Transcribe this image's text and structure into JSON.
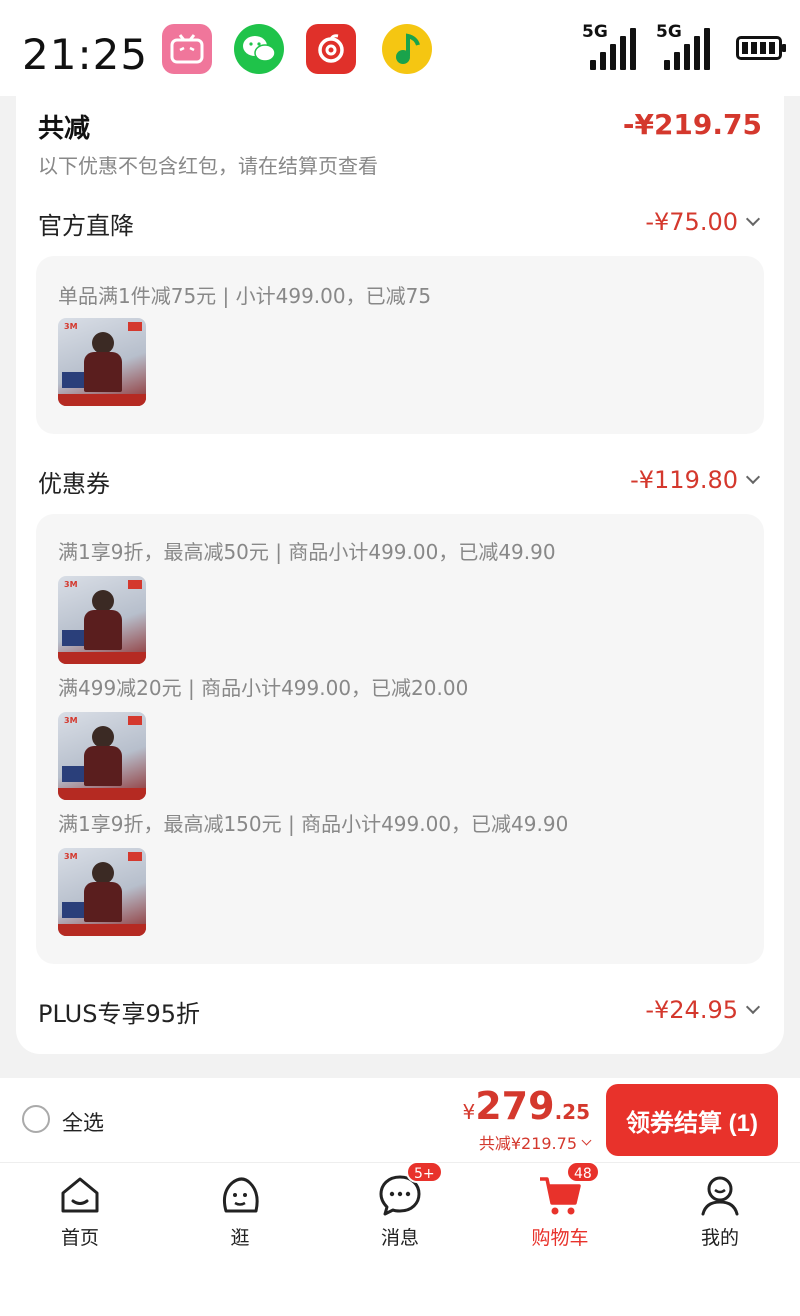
{
  "status_bar": {
    "time": "21:25",
    "apps": [
      "bilibili-icon",
      "wechat-icon",
      "netease-music-icon",
      "qq-music-icon"
    ],
    "signal_1": "5G",
    "signal_2": "5G"
  },
  "discount_summary": {
    "title": "共减",
    "amount": "-¥219.75",
    "note": "以下优惠不包含红包，请在结算页查看"
  },
  "official_discount": {
    "title": "官方直降",
    "amount": "-¥75.00",
    "items": [
      {
        "desc": "单品满1件减75元 | 小计499.00，已减75"
      }
    ]
  },
  "coupons": {
    "title": "优惠券",
    "amount": "-¥119.80",
    "items": [
      {
        "desc": "满1享9折，最高减50元 | 商品小计499.00，已减49.90"
      },
      {
        "desc": "满499减20元 | 商品小计499.00，已减20.00"
      },
      {
        "desc": "满1享9折，最高减150元 | 商品小计499.00，已减49.90"
      }
    ]
  },
  "plus": {
    "title": "PLUS专享95折",
    "amount": "-¥24.95"
  },
  "checkout": {
    "select_all": "全选",
    "currency": "¥",
    "price_int": "279",
    "price_dec": ".25",
    "saving": "共减¥219.75",
    "button": "领券结算 (1)"
  },
  "tabs": [
    {
      "label": "首页",
      "icon": "home-icon"
    },
    {
      "label": "逛",
      "icon": "browse-icon"
    },
    {
      "label": "消息",
      "icon": "message-icon",
      "badge": "5+"
    },
    {
      "label": "购物车",
      "icon": "cart-icon",
      "badge": "48"
    },
    {
      "label": "我的",
      "icon": "profile-icon"
    }
  ],
  "colors": {
    "accent": "#e8322b",
    "discount_text": "#d4382d",
    "muted_text": "#888888"
  }
}
